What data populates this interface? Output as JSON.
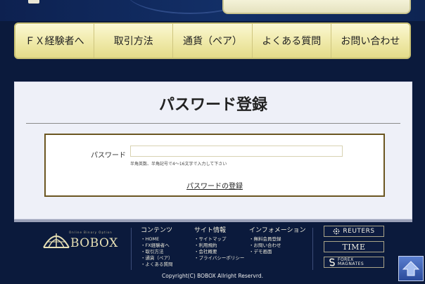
{
  "nav": {
    "items": [
      {
        "label": "ＦＸ経験者へ"
      },
      {
        "label": "取引方法"
      },
      {
        "label": "通貨（ペア）"
      },
      {
        "label": "よくある質問"
      },
      {
        "label": "お問い合わせ"
      }
    ]
  },
  "page": {
    "title": "パスワード登録"
  },
  "form": {
    "password_label": "パスワード",
    "password_value": "",
    "hint": "半角英数、半角記号で4〜16文字で入力して下さい",
    "submit_label": "パスワードの登録"
  },
  "footer": {
    "logo_text": "BOBOX",
    "logo_tagline": "Online Binary Option",
    "columns": [
      {
        "title": "コンテンツ",
        "items": [
          "・HOME",
          "・FX経験者へ",
          "・取引方法",
          "・通貨（ペア）",
          "・よくある質問"
        ]
      },
      {
        "title": "サイト情報",
        "items": [
          "・サイトマップ",
          "・利用規約",
          "・会社概要",
          "・プライバシーポリシー"
        ]
      },
      {
        "title": "インフォメーション",
        "items": [
          "・無料会員登録",
          "・お問い合わせ",
          "・デモ画面"
        ]
      }
    ],
    "partners": {
      "reuters": "REUTERS",
      "time": "TIME",
      "forex_line1": "FOREX",
      "forex_line2": "MAGNATES"
    },
    "copyright": "Copyright(C) BOBOX Allright Reservrd."
  },
  "colors": {
    "background": "#0b1a3c",
    "nav_gold": "#efe9a8",
    "form_border": "#6b5621",
    "card": "#eef0f8"
  }
}
